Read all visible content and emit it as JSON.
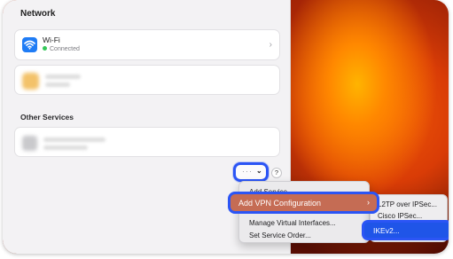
{
  "pane": {
    "title": "Network"
  },
  "wifi": {
    "name": "Wi-Fi",
    "status": "Connected",
    "chevron": "›"
  },
  "other_services": {
    "title": "Other Services"
  },
  "toolbar": {
    "more_dots": "···",
    "more_chevron": "⌄",
    "help": "?"
  },
  "menu": {
    "items": [
      {
        "label": "Add Service..."
      },
      {
        "label": "Add VPN Configuration"
      },
      {
        "label": "Manage Virtual Interfaces..."
      },
      {
        "label": "Set Service Order..."
      }
    ],
    "submenu_arrow": "›"
  },
  "submenu": {
    "items": [
      {
        "label": "L2TP over IPSec..."
      },
      {
        "label": "Cisco IPSec..."
      },
      {
        "label": "IKEv2..."
      }
    ]
  },
  "colors": {
    "highlight_outline": "#2b55f5",
    "selected_item": "#c56c54",
    "ikev2_selected": "#1f55e8",
    "status_green": "#34c759",
    "wifi_blue": "#1f7cf5"
  }
}
